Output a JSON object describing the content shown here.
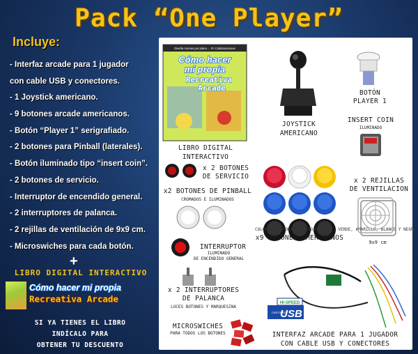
{
  "title": "Pack “One Player”",
  "incluye": "Incluye:",
  "items": [
    "- Interfaz arcade para 1 jugador",
    "con cable USB y conectores.",
    "- 1 Joystick americano.",
    "- 9 botones arcade americanos.",
    "- Botón “Player 1” serigrafiado.",
    "- 2 botones para Pinball (laterales).",
    "- Botón iluminado tipo “insert coin”.",
    "- 2 botones de servicio.",
    "- Interruptor de encendido general.",
    "- 2 interruptores de palanca.",
    "- 2 rejillas de ventilación de 9x9 cm.",
    "- Microswiches para cada botón."
  ],
  "plus": "+",
  "libro_heading": "LIBRO DIGITAL INTERACTIVO",
  "logo_line1": "Cómo hacer mi propia",
  "logo_line2": "Recreativa Arcade",
  "promo": [
    "SI YA TIENES EL LIBRO",
    "INDÍCALO PARA",
    "OBTENER TU DESCUENTO"
  ],
  "panel": {
    "book_label": [
      "LIBRO DIGITAL",
      "INTERACTIVO"
    ],
    "book_cover_top": "Diseña montes por plana ... Pc Colaboraciones",
    "book_cover_title": [
      "Cómo hacer",
      "mi propia",
      "Recreativa",
      "Arcade"
    ],
    "joystick_label": [
      "JOYSTICK",
      "AMERICANO"
    ],
    "player1_label": [
      "BOTÓN",
      "PLAYER 1"
    ],
    "insertcoin_label": "INSERT COIN",
    "insertcoin_sub": "ILUMINADO",
    "servicio_label": "x 2 BOTONES",
    "servicio_sub": "DE SERVICIO",
    "pinball_label": "x2 BOTONES DE PINBALL",
    "pinball_sub": "CROMADOS E ILUMINADOS",
    "rejillas_label": [
      "x 2 REJILLAS",
      "DE VENTILACION"
    ],
    "rejillas_size": "9x9 cm",
    "colores_label": "COLORES DISPONIBLES: ROJO, AZUL, VERDE, AMARILLO, BLANCO Y NEGRO",
    "americanos_label": "x9 BOTONES AMERICANOS",
    "interruptor_label": "INTERRUPTOR",
    "interruptor_sub": [
      "ILUMINADO",
      "DE ENCENDIDO GENERAL"
    ],
    "palanca_label": [
      "x 2 INTERRUPTORES",
      "DE PALANCA"
    ],
    "palanca_sub": "LUCES BOTONES Y MARQUESINA",
    "microswiches_label": "MICROSWICHES",
    "microswiches_sub": "PARA TODOS LOS BOTONES",
    "usb_badge_top": "HI-SPEED",
    "usb_badge_cert": "CERTIFIED",
    "usb_badge_main": "USB",
    "interfaz_label": [
      "INTERFAZ ARCADE PARA 1 JUGADOR",
      "CON CABLE USB Y CONECTORES"
    ]
  },
  "colors": {
    "title_yellow": "#f4c21a",
    "background_blue": "#1a3868",
    "button_red": "#c8102e",
    "button_blue": "#1f56c4",
    "button_yellow": "#f2c200",
    "button_white": "#f2f2f2",
    "button_black": "#151515"
  }
}
